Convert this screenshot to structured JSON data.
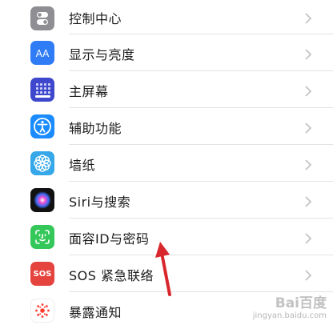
{
  "settings": {
    "items": [
      {
        "label": "控制中心",
        "icon": "control-center-icon",
        "color": "#8e8e93"
      },
      {
        "label": "显示与亮度",
        "icon": "display-brightness-icon",
        "color": "#2f7cf6"
      },
      {
        "label": "主屏幕",
        "icon": "home-screen-icon",
        "color": "#3f48cc"
      },
      {
        "label": "辅助功能",
        "icon": "accessibility-icon",
        "color": "#1a8cff"
      },
      {
        "label": "墙纸",
        "icon": "wallpaper-icon",
        "color": "#36a7e8"
      },
      {
        "label": "Siri与搜索",
        "icon": "siri-icon",
        "color": "#111111"
      },
      {
        "label": "面容ID与密码",
        "icon": "face-id-icon",
        "color": "#34c759"
      },
      {
        "label": "SOS 紧急联络",
        "icon": "sos-icon",
        "color": "#e5443e"
      },
      {
        "label": "暴露通知",
        "icon": "exposure-notification-icon",
        "color": "#ff3b30"
      }
    ]
  },
  "sos_icon_text": "SOS",
  "watermark": {
    "brand": "Bai百度",
    "url": "jingyan.baidu.com"
  },
  "annotation": {
    "arrow_color": "#d9272e"
  }
}
